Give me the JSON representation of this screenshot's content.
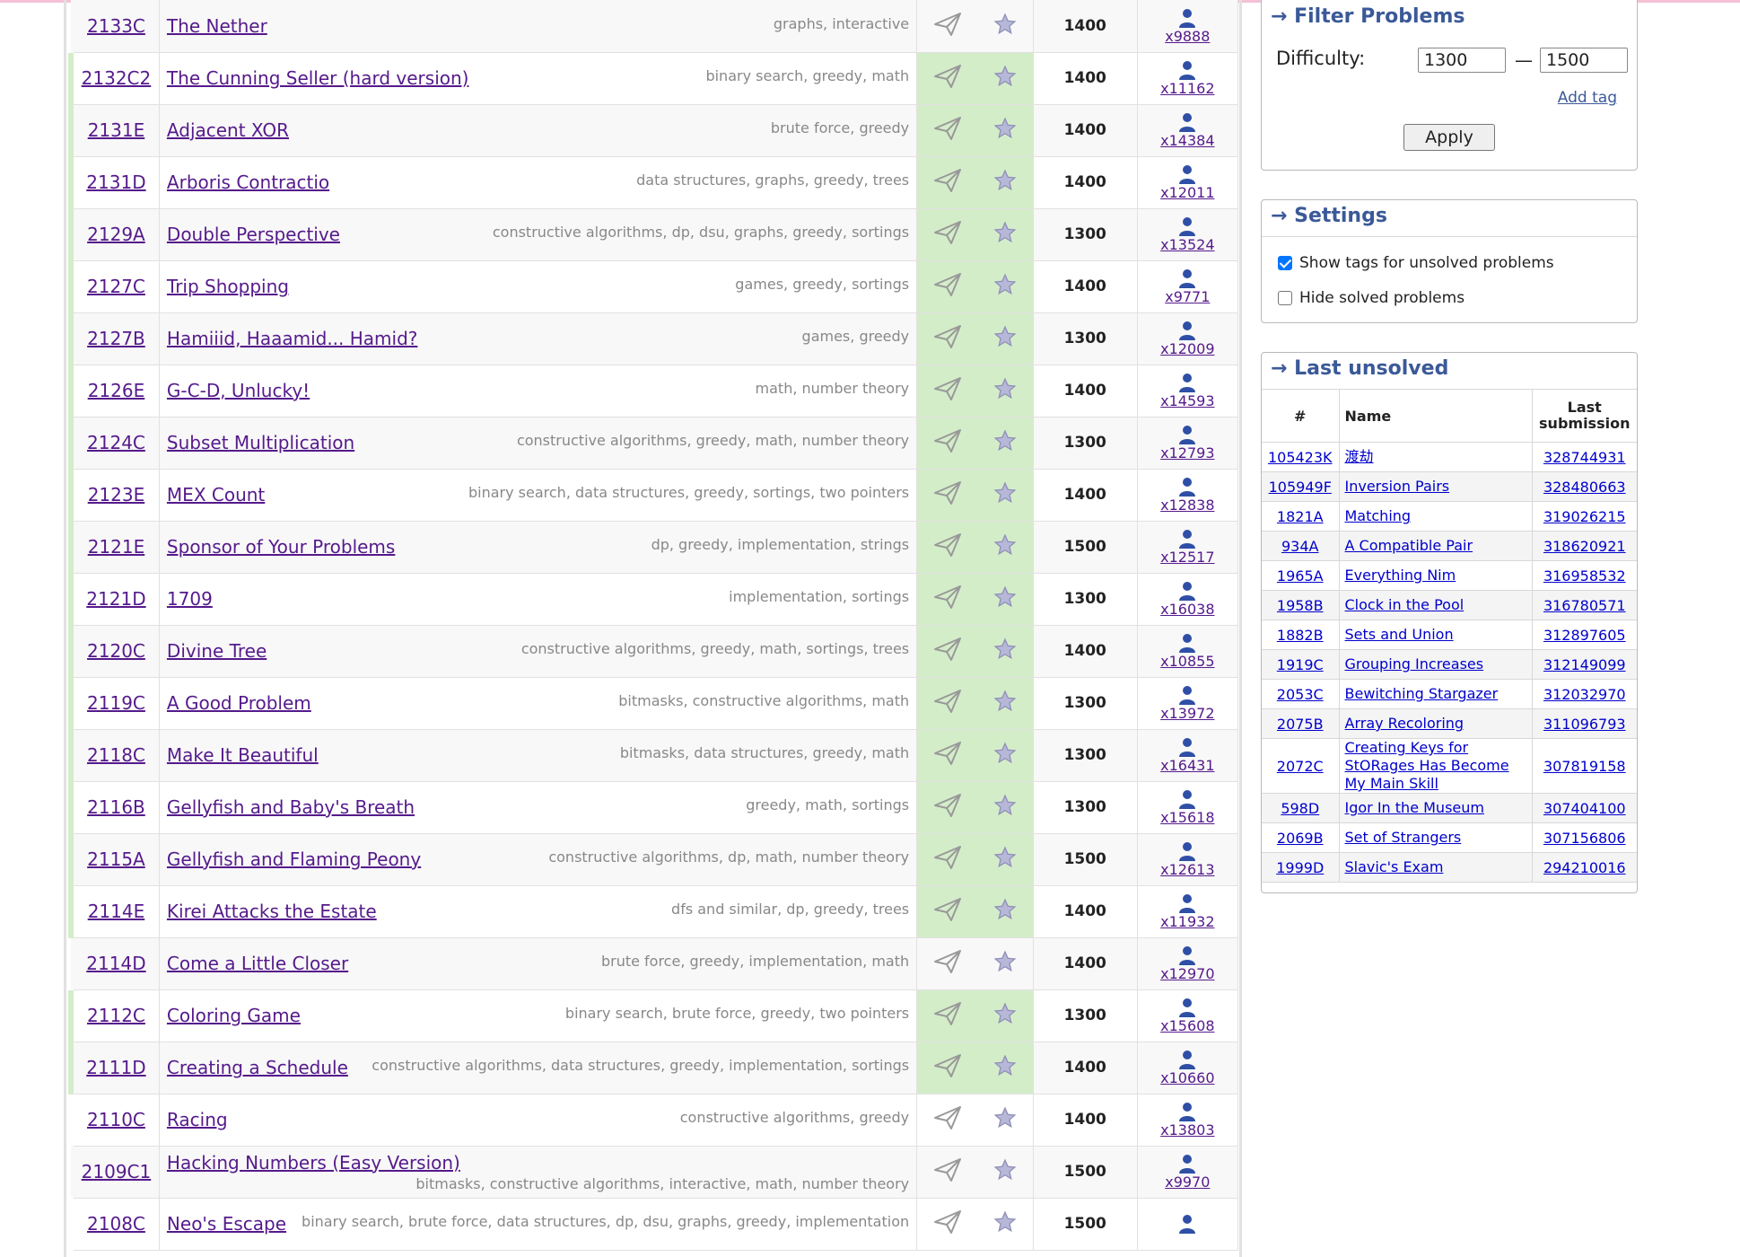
{
  "problems": [
    {
      "id": "2133C",
      "name": "The Nether",
      "tags": [
        "graphs",
        "interactive"
      ],
      "rating": "1400",
      "solved_count": "x9888",
      "solved": false
    },
    {
      "id": "2132C2",
      "name": "The Cunning Seller (hard version)",
      "tags": [
        "binary search",
        "greedy",
        "math"
      ],
      "rating": "1400",
      "solved_count": "x11162",
      "solved": true
    },
    {
      "id": "2131E",
      "name": "Adjacent XOR",
      "tags": [
        "brute force",
        "greedy"
      ],
      "rating": "1400",
      "solved_count": "x14384",
      "solved": true
    },
    {
      "id": "2131D",
      "name": "Arboris Contractio",
      "tags": [
        "data structures",
        "graphs",
        "greedy",
        "trees"
      ],
      "rating": "1400",
      "solved_count": "x12011",
      "solved": true
    },
    {
      "id": "2129A",
      "name": "Double Perspective",
      "tags": [
        "constructive algorithms",
        "dp",
        "dsu",
        "graphs",
        "greedy",
        "sortings"
      ],
      "rating": "1300",
      "solved_count": "x13524",
      "solved": true
    },
    {
      "id": "2127C",
      "name": "Trip Shopping",
      "tags": [
        "games",
        "greedy",
        "sortings"
      ],
      "rating": "1400",
      "solved_count": "x9771",
      "solved": true
    },
    {
      "id": "2127B",
      "name": "Hamiiid, Haaamid... Hamid?",
      "tags": [
        "games",
        "greedy"
      ],
      "rating": "1300",
      "solved_count": "x12009",
      "solved": true
    },
    {
      "id": "2126E",
      "name": "G-C-D, Unlucky!",
      "tags": [
        "math",
        "number theory"
      ],
      "rating": "1400",
      "solved_count": "x14593",
      "solved": true
    },
    {
      "id": "2124C",
      "name": "Subset Multiplication",
      "tags": [
        "constructive algorithms",
        "greedy",
        "math",
        "number theory"
      ],
      "rating": "1300",
      "solved_count": "x12793",
      "solved": true
    },
    {
      "id": "2123E",
      "name": "MEX Count",
      "tags": [
        "binary search",
        "data structures",
        "greedy",
        "sortings",
        "two pointers"
      ],
      "rating": "1400",
      "solved_count": "x12838",
      "solved": true
    },
    {
      "id": "2121E",
      "name": "Sponsor of Your Problems",
      "tags": [
        "dp",
        "greedy",
        "implementation",
        "strings"
      ],
      "rating": "1500",
      "solved_count": "x12517",
      "solved": true
    },
    {
      "id": "2121D",
      "name": "1709",
      "tags": [
        "implementation",
        "sortings"
      ],
      "rating": "1300",
      "solved_count": "x16038",
      "solved": true
    },
    {
      "id": "2120C",
      "name": "Divine Tree",
      "tags": [
        "constructive algorithms",
        "greedy",
        "math",
        "sortings",
        "trees"
      ],
      "rating": "1400",
      "solved_count": "x10855",
      "solved": true
    },
    {
      "id": "2119C",
      "name": "A Good Problem",
      "tags": [
        "bitmasks",
        "constructive algorithms",
        "math"
      ],
      "rating": "1300",
      "solved_count": "x13972",
      "solved": true
    },
    {
      "id": "2118C",
      "name": "Make It Beautiful",
      "tags": [
        "bitmasks",
        "data structures",
        "greedy",
        "math"
      ],
      "rating": "1300",
      "solved_count": "x16431",
      "solved": true
    },
    {
      "id": "2116B",
      "name": "Gellyfish and Baby's Breath",
      "tags": [
        "greedy",
        "math",
        "sortings"
      ],
      "rating": "1300",
      "solved_count": "x15618",
      "solved": true
    },
    {
      "id": "2115A",
      "name": "Gellyfish and Flaming Peony",
      "tags": [
        "constructive algorithms",
        "dp",
        "math",
        "number theory"
      ],
      "rating": "1500",
      "solved_count": "x12613",
      "solved": true
    },
    {
      "id": "2114E",
      "name": "Kirei Attacks the Estate",
      "tags": [
        "dfs and similar",
        "dp",
        "greedy",
        "trees"
      ],
      "rating": "1400",
      "solved_count": "x11932",
      "solved": true
    },
    {
      "id": "2114D",
      "name": "Come a Little Closer",
      "tags": [
        "brute force",
        "greedy",
        "implementation",
        "math"
      ],
      "rating": "1400",
      "solved_count": "x12970",
      "solved": false
    },
    {
      "id": "2112C",
      "name": "Coloring Game",
      "tags": [
        "binary search",
        "brute force",
        "greedy",
        "two pointers"
      ],
      "rating": "1300",
      "solved_count": "x15608",
      "solved": true
    },
    {
      "id": "2111D",
      "name": "Creating a Schedule",
      "tags": [
        "constructive algorithms",
        "data structures",
        "greedy",
        "implementation",
        "sortings"
      ],
      "rating": "1400",
      "solved_count": "x10660",
      "solved": true
    },
    {
      "id": "2110C",
      "name": "Racing",
      "tags": [
        "constructive algorithms",
        "greedy"
      ],
      "rating": "1400",
      "solved_count": "x13803",
      "solved": false
    },
    {
      "id": "2109C1",
      "name": "Hacking Numbers (Easy Version)",
      "tags": [
        "bitmasks",
        "constructive algorithms",
        "interactive",
        "math",
        "number theory"
      ],
      "rating": "1500",
      "solved_count": "x9970",
      "solved": false
    },
    {
      "id": "2108C",
      "name": "Neo's Escape",
      "tags": [
        "binary search",
        "brute force",
        "data structures",
        "dp",
        "dsu",
        "graphs",
        "greedy",
        "implementation"
      ],
      "rating": "1500",
      "solved_count": "",
      "solved": false
    }
  ],
  "filter": {
    "title": "→ Filter Problems",
    "difficulty_label": "Difficulty:",
    "min": "1300",
    "dash": "—",
    "max": "1500",
    "add_tag": "Add tag",
    "apply": "Apply"
  },
  "settings": {
    "title": "→ Settings",
    "show_tags": "Show tags for unsolved problems",
    "show_tags_checked": true,
    "hide_solved": "Hide solved problems",
    "hide_solved_checked": false
  },
  "last_unsolved": {
    "title": "→ Last unsolved",
    "headers": [
      "#",
      "Name",
      "Last submission"
    ],
    "rows": [
      {
        "id": "105423K",
        "name": "渡劫",
        "sub": "328744931"
      },
      {
        "id": "105949F",
        "name": "Inversion Pairs",
        "sub": "328480663"
      },
      {
        "id": "1821A",
        "name": "Matching",
        "sub": "319026215"
      },
      {
        "id": "934A",
        "name": "A Compatible Pair",
        "sub": "318620921"
      },
      {
        "id": "1965A",
        "name": "Everything Nim",
        "sub": "316958532"
      },
      {
        "id": "1958B",
        "name": "Clock in the Pool",
        "sub": "316780571"
      },
      {
        "id": "1882B",
        "name": "Sets and Union",
        "sub": "312897605"
      },
      {
        "id": "1919C",
        "name": "Grouping Increases",
        "sub": "312149099"
      },
      {
        "id": "2053C",
        "name": "Bewitching Stargazer",
        "sub": "312032970"
      },
      {
        "id": "2075B",
        "name": "Array Recoloring",
        "sub": "311096793"
      },
      {
        "id": "2072C",
        "name": "Creating Keys for StORages Has Become My Main Skill",
        "sub": "307819158"
      },
      {
        "id": "598D",
        "name": "Igor In the Museum",
        "sub": "307404100"
      },
      {
        "id": "2069B",
        "name": "Set of Strangers",
        "sub": "307156806"
      },
      {
        "id": "1999D",
        "name": "Slavic's Exam",
        "sub": "294210016"
      }
    ]
  },
  "colors": {
    "solved": "#d4edc9",
    "title": "#3b5998",
    "link": "#551a8b"
  }
}
